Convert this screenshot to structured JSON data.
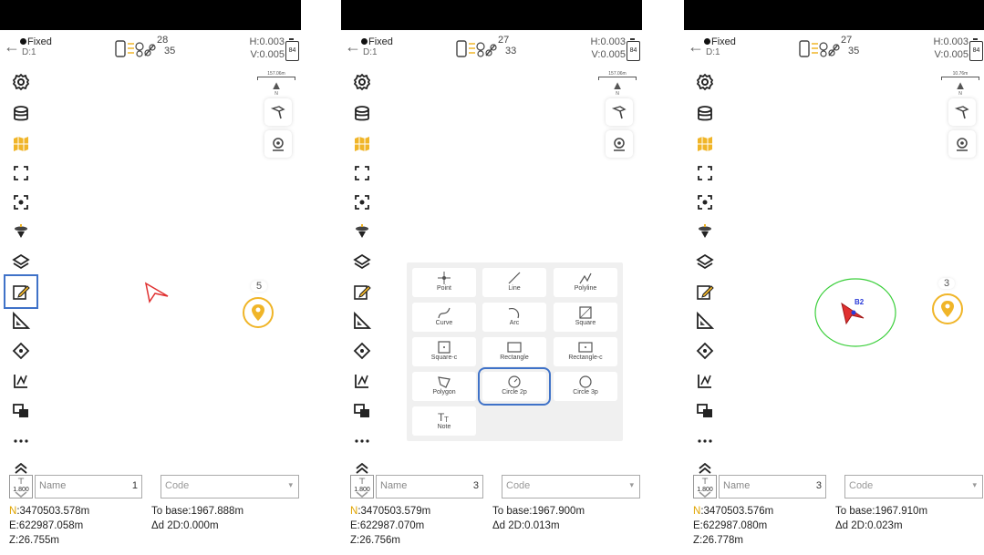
{
  "panels": [
    {
      "fix": "Fixed",
      "d": "D:1",
      "sat_top": "28",
      "sat_bottom": "35",
      "h": "H:0.003",
      "v": "V:0.005",
      "battery": "84",
      "scale": "157.06m",
      "compass": "N",
      "point_count": "5",
      "rod": "1.800",
      "name_placeholder": "Name",
      "name_num": "1",
      "code_placeholder": "Code",
      "n": "N:3470503.578m",
      "e": "E:622987.058m",
      "z": "Z:26.755m",
      "to_base": "To base:1967.888m",
      "delta": "Δd 2D:0.000m"
    },
    {
      "fix": "Fixed",
      "d": "D:1",
      "sat_top": "27",
      "sat_bottom": "33",
      "h": "H:0.003",
      "v": "V:0.005",
      "battery": "84",
      "scale": "157.06m",
      "compass": "N",
      "point_count": "",
      "rod": "1.800",
      "name_placeholder": "Name",
      "name_num": "3",
      "code_placeholder": "Code",
      "n": "N:3470503.579m",
      "e": "E:622987.070m",
      "z": "Z:26.756m",
      "to_base": "To base:1967.900m",
      "delta": "Δd 2D:0.013m"
    },
    {
      "fix": "Fixed",
      "d": "D:1",
      "sat_top": "27",
      "sat_bottom": "35",
      "h": "H:0.003",
      "v": "V:0.005",
      "battery": "84",
      "scale": "10.76m",
      "compass": "N",
      "point_count": "3",
      "point_label": "B2",
      "rod": "1.800",
      "name_placeholder": "Name",
      "name_num": "3",
      "code_placeholder": "Code",
      "n": "N:3470503.576m",
      "e": "E:622987.080m",
      "z": "Z:26.778m",
      "to_base": "To base:1967.910m",
      "delta": "Δd 2D:0.023m"
    }
  ],
  "draw_tools": [
    "Point",
    "Line",
    "Polyline",
    "Curve",
    "Arc",
    "Square",
    "Square-c",
    "Rectangle",
    "Rectangle-c",
    "Polygon",
    "Circle 2p",
    "Circle 3p",
    "Note"
  ],
  "colors": {
    "accent_yellow": "#f0b528",
    "highlight_blue": "#3f72c8",
    "gps_red": "#e03030",
    "circle_green": "#3bcf3b"
  }
}
